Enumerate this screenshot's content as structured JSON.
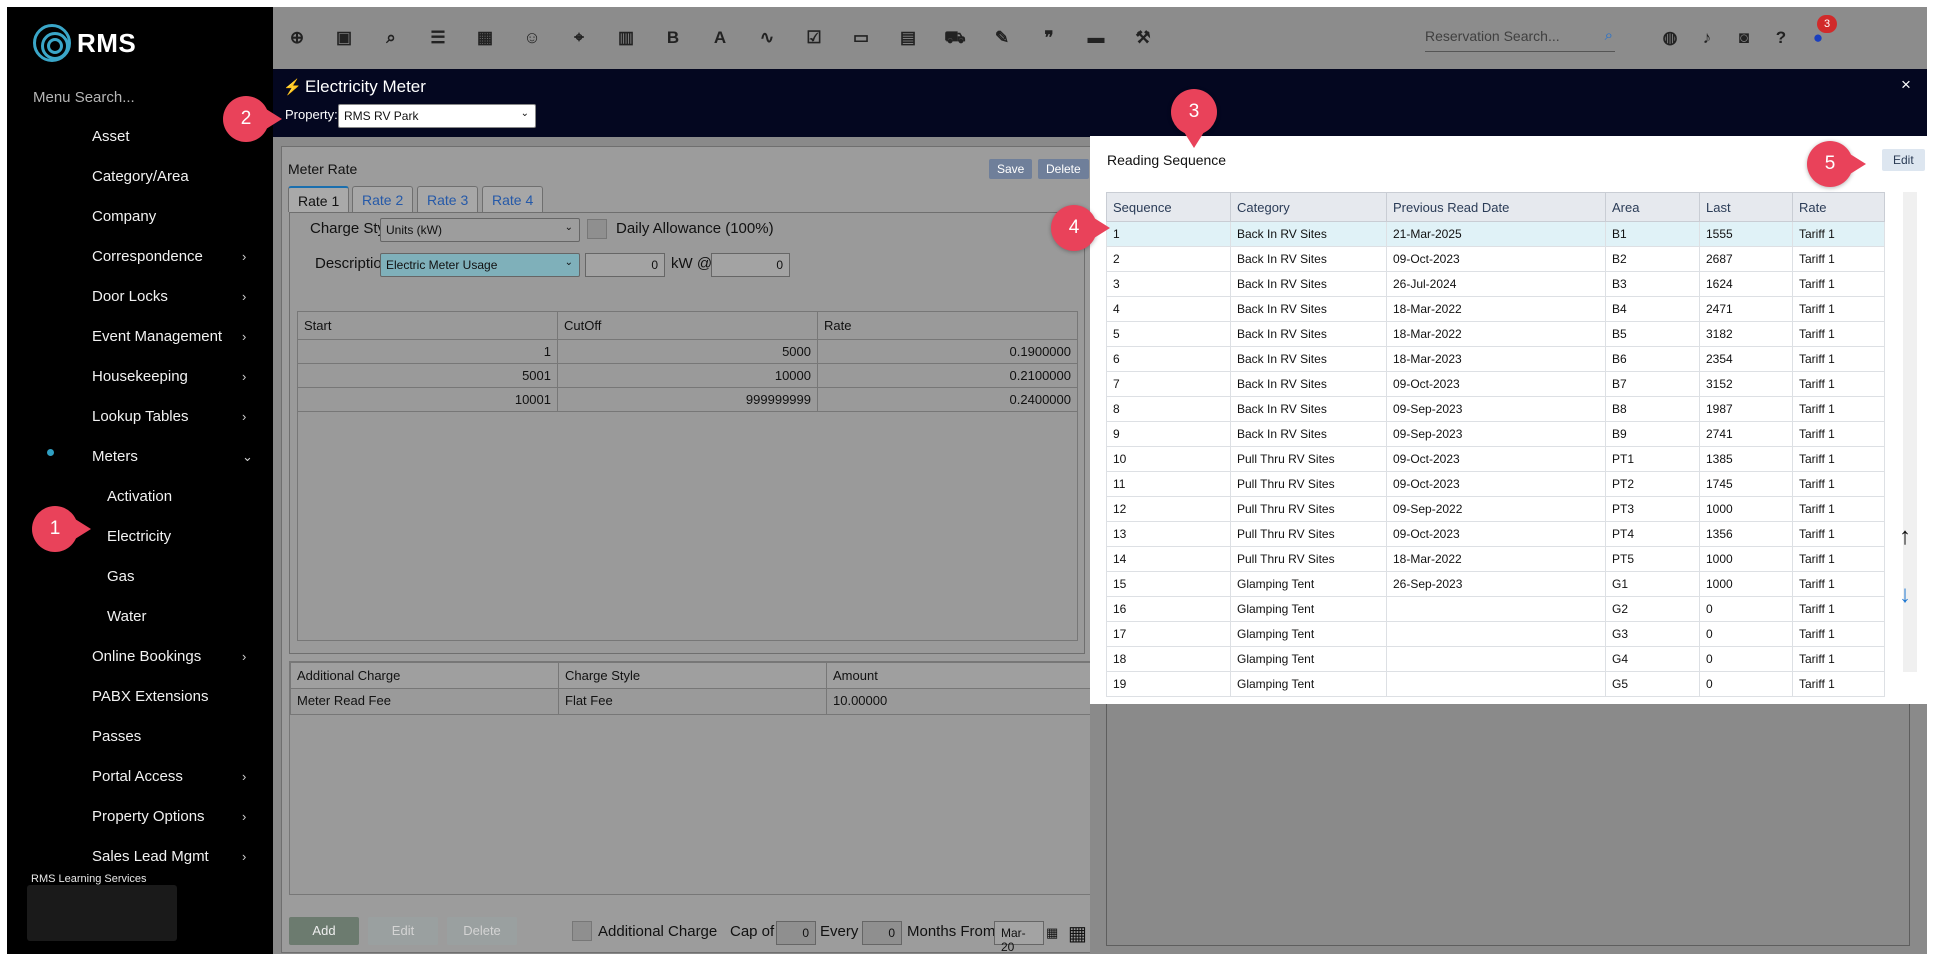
{
  "brand": {
    "name": "RMS"
  },
  "sidebar": {
    "search_placeholder": "Menu Search...",
    "items": [
      {
        "label": "Asset",
        "chevron": false
      },
      {
        "label": "Category/Area",
        "chevron": false
      },
      {
        "label": "Company",
        "chevron": false
      },
      {
        "label": "Correspondence",
        "chevron": true
      },
      {
        "label": "Door Locks",
        "chevron": true
      },
      {
        "label": "Event Management",
        "chevron": true
      },
      {
        "label": "Housekeeping",
        "chevron": true
      },
      {
        "label": "Lookup Tables",
        "chevron": true
      },
      {
        "label": "Meters",
        "chevron": true,
        "expanded": true
      },
      {
        "label": "Activation",
        "sub": true
      },
      {
        "label": "Electricity",
        "sub": true,
        "selected": true
      },
      {
        "label": "Gas",
        "sub": true
      },
      {
        "label": "Water",
        "sub": true
      },
      {
        "label": "Online Bookings",
        "chevron": true
      },
      {
        "label": "PABX Extensions",
        "chevron": false
      },
      {
        "label": "Passes",
        "chevron": false
      },
      {
        "label": "Portal Access",
        "chevron": true
      },
      {
        "label": "Property Options",
        "chevron": true
      },
      {
        "label": "Sales Lead Mgmt",
        "chevron": true
      }
    ],
    "footer": "RMS Learning Services"
  },
  "toolbar": {
    "icons": [
      "add-icon",
      "calendar-icon",
      "search-icon",
      "filter-icon",
      "grid-icon",
      "guests-icon",
      "map-pin-icon",
      "map-icon",
      "bold-icon",
      "text-icon",
      "chart-icon",
      "checklist-icon",
      "card-icon",
      "document-icon",
      "cart-icon",
      "note-icon",
      "quote-icon",
      "bed-icon",
      "hammer-icon"
    ],
    "reservation_search_placeholder": "Reservation Search...",
    "notification_count": "3"
  },
  "meter_window": {
    "title": "Electricity Meter",
    "property_label": "Property:",
    "property_value": "RMS RV Park",
    "close": "×"
  },
  "meter_rate": {
    "title": "Meter Rate",
    "save": "Save",
    "delete": "Delete",
    "tabs": [
      "Rate 1",
      "Rate 2",
      "Rate 3",
      "Rate 4"
    ],
    "charge_style_label": "Charge Style",
    "charge_style_value": "Units (kW)",
    "daily_allowance_label": "Daily Allowance (100%)",
    "description_label": "Description",
    "description_value": "Electric Meter Usage",
    "kw_value": "0",
    "kw_label": "kW @",
    "at_value": "0",
    "tier_headers": [
      "Start",
      "CutOff",
      "Rate"
    ],
    "tiers": [
      [
        "1",
        "5000",
        "0.1900000"
      ],
      [
        "5001",
        "10000",
        "0.2100000"
      ],
      [
        "10001",
        "999999999",
        "0.2400000"
      ]
    ]
  },
  "additional_charges": {
    "headers": [
      "Additional Charge",
      "Charge Style",
      "Amount"
    ],
    "rows": [
      [
        "Meter Read Fee",
        "Flat Fee",
        "10.00000"
      ]
    ],
    "add": "Add",
    "edit": "Edit",
    "delete": "Delete",
    "additional_charge_label": "Additional Charge",
    "cap_of_label": "Cap of",
    "cap_of_value": "0",
    "every_label": "Every",
    "every_value": "0",
    "months_from_label": "Months From",
    "months_from_value": "Mar-20"
  },
  "reading_sequence": {
    "title": "Reading Sequence",
    "edit": "Edit",
    "headers": [
      "Sequence",
      "Category",
      "Previous Read Date",
      "Area",
      "Last",
      "Rate"
    ],
    "rows": [
      [
        "1",
        "Back In RV Sites",
        "21-Mar-2025",
        "B1",
        "1555",
        "Tariff 1"
      ],
      [
        "2",
        "Back In RV Sites",
        "09-Oct-2023",
        "B2",
        "2687",
        "Tariff 1"
      ],
      [
        "3",
        "Back In RV Sites",
        "26-Jul-2024",
        "B3",
        "1624",
        "Tariff 1"
      ],
      [
        "4",
        "Back In RV Sites",
        "18-Mar-2022",
        "B4",
        "2471",
        "Tariff 1"
      ],
      [
        "5",
        "Back In RV Sites",
        "18-Mar-2022",
        "B5",
        "3182",
        "Tariff 1"
      ],
      [
        "6",
        "Back In RV Sites",
        "18-Mar-2023",
        "B6",
        "2354",
        "Tariff 1"
      ],
      [
        "7",
        "Back In RV Sites",
        "09-Oct-2023",
        "B7",
        "3152",
        "Tariff 1"
      ],
      [
        "8",
        "Back In RV Sites",
        "09-Sep-2023",
        "B8",
        "1987",
        "Tariff 1"
      ],
      [
        "9",
        "Back In RV Sites",
        "09-Sep-2023",
        "B9",
        "2741",
        "Tariff 1"
      ],
      [
        "10",
        "Pull Thru RV Sites",
        "09-Oct-2023",
        "PT1",
        "1385",
        "Tariff 1"
      ],
      [
        "11",
        "Pull Thru RV Sites",
        "09-Oct-2023",
        "PT2",
        "1745",
        "Tariff 1"
      ],
      [
        "12",
        "Pull Thru RV Sites",
        "09-Sep-2022",
        "PT3",
        "1000",
        "Tariff 1"
      ],
      [
        "13",
        "Pull Thru RV Sites",
        "09-Oct-2023",
        "PT4",
        "1356",
        "Tariff 1"
      ],
      [
        "14",
        "Pull Thru RV Sites",
        "18-Mar-2022",
        "PT5",
        "1000",
        "Tariff 1"
      ],
      [
        "15",
        "Glamping Tent",
        "26-Sep-2023",
        "G1",
        "1000",
        "Tariff 1"
      ],
      [
        "16",
        "Glamping Tent",
        "",
        "G2",
        "0",
        "Tariff 1"
      ],
      [
        "17",
        "Glamping Tent",
        "",
        "G3",
        "0",
        "Tariff 1"
      ],
      [
        "18",
        "Glamping Tent",
        "",
        "G4",
        "0",
        "Tariff 1"
      ],
      [
        "19",
        "Glamping Tent",
        "",
        "G5",
        "0",
        "Tariff 1"
      ]
    ]
  },
  "callouts": [
    "1",
    "2",
    "3",
    "4",
    "5"
  ],
  "colors": {
    "callout": "#e9425a",
    "header_dark": "#040720",
    "accent": "#2f9fc2"
  }
}
